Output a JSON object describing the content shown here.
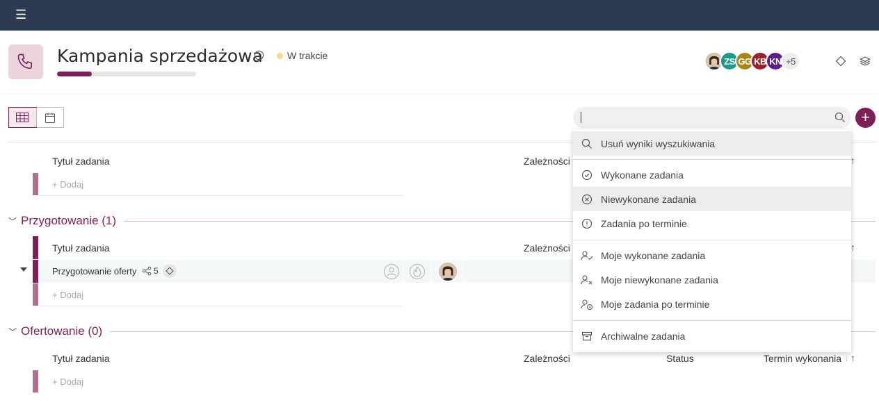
{
  "app": {
    "menu_icon": "hamburger-icon"
  },
  "project": {
    "title": "Kampania sprzedażowa",
    "status": "W trakcie",
    "status_color": "#f2dd8a",
    "progress_percent": 25,
    "icon": "phone-icon",
    "accent": "#7e1f58"
  },
  "team": {
    "members": [
      {
        "initials": "",
        "color": "#5a3a2a",
        "photo": true
      },
      {
        "initials": "ZS",
        "color": "#1a9a8a"
      },
      {
        "initials": "GG",
        "color": "#a8851a"
      },
      {
        "initials": "KB",
        "color": "#a01f2a"
      },
      {
        "initials": "KN",
        "color": "#5e1f8a"
      }
    ],
    "more": "+5"
  },
  "toolbar": {
    "search_value": "",
    "add_label": "+"
  },
  "table": {
    "col_title": "Tytuł zadania",
    "col_deps": "Zależności",
    "col_status": "Status",
    "col_due": "Termin wykonania",
    "add_label": "+ Dodaj"
  },
  "groups": [
    {
      "title": "Przygotowanie (1)",
      "tasks": [
        {
          "name": "Przygotowanie oferty",
          "subtasks": "5"
        }
      ]
    },
    {
      "title": "Ofertowanie (0)",
      "tasks": []
    }
  ],
  "search_menu": {
    "clear": "Usuń wyniki wyszukiwania",
    "done": "Wykonane zadania",
    "not_done": "Niewykonane zadania",
    "overdue": "Zadania po terminie",
    "my_done": "Moje wykonane zadania",
    "my_not_done": "Moje niewykonane zadania",
    "my_overdue": "Moje zadania po terminie",
    "archived": "Archiwalne zadania"
  }
}
